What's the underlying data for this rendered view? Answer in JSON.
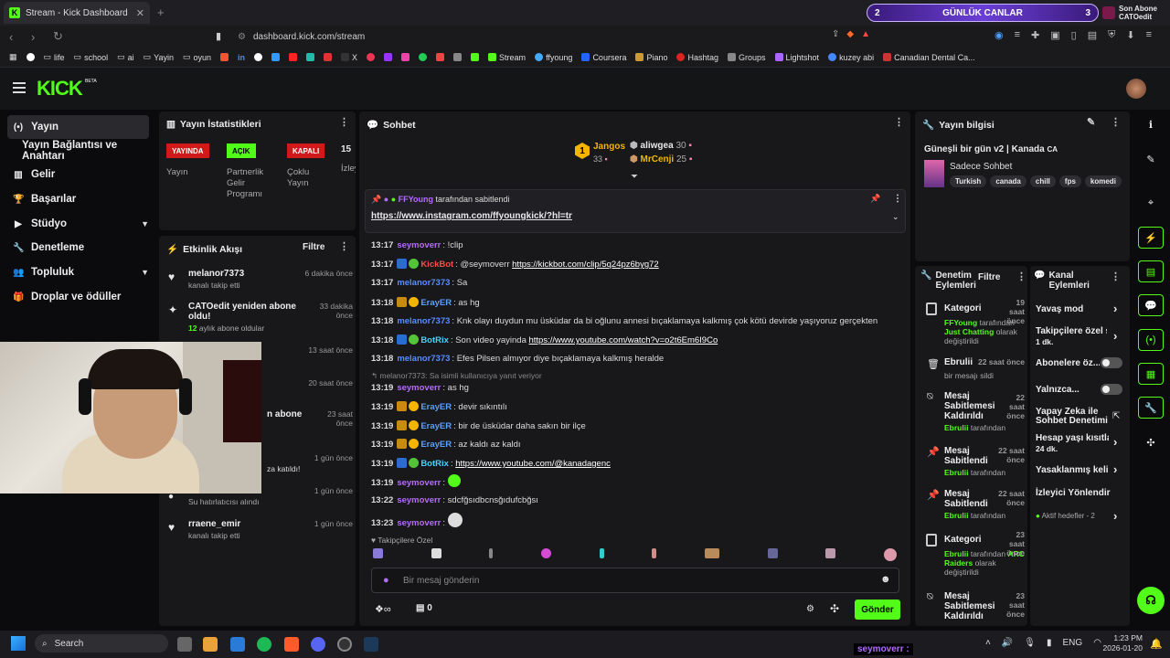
{
  "browser": {
    "tab_title": "Stream - Kick Dashboard",
    "url": "dashboard.kick.com/stream",
    "bookmarks": [
      "life",
      "school",
      "ai",
      "Yayin",
      "oyun",
      "in",
      "X",
      "Stream",
      "ffyoung",
      "Coursera",
      "Piano",
      "Hashtag",
      "Groups",
      "Lightshot",
      "kuzey abi",
      "Canadian Dental Ca..."
    ]
  },
  "banner": {
    "left": "2",
    "label": "GÜNLÜK CANLAR",
    "right": "3"
  },
  "subscriber": {
    "title": "Son Abone",
    "name": "CATOedit"
  },
  "brand": {
    "logo": "KICK",
    "beta": "BETA"
  },
  "sidebar": {
    "items": [
      "Yayın",
      "Yayın Bağlantısı ve Anahtarı",
      "Gelir",
      "Başarılar",
      "Stüdyo",
      "Denetleme",
      "Topluluk",
      "Droplar ve ödüller"
    ]
  },
  "stats": {
    "title": "Yayın İstatistikleri",
    "b1": "YAYINDA",
    "b2": "AÇIK",
    "b3": "KAPALI",
    "b4": "15",
    "l1": "Yayın",
    "l2": "Partnerlik Gelir Programı",
    "l3": "Çoklu Yayın",
    "l4": "İzley"
  },
  "feed": {
    "title": "Etkinlik Akışı",
    "filter": "Filtre",
    "items": [
      {
        "name": "melanor7373",
        "sub": "kanalı takip etti",
        "time": "6 dakika önce"
      },
      {
        "name": "CATOedit yeniden abone oldu!",
        "sub": "aylık abone oldular",
        "sub_count": "12",
        "time": "33 dakika önce"
      },
      {
        "name": "",
        "sub": "",
        "time": "13 saat önce"
      },
      {
        "name": "",
        "sub": "",
        "time": "20 saat önce"
      },
      {
        "name": "n abone",
        "sub": "",
        "time": "23 saat önce"
      },
      {
        "name": "",
        "sub": "za katıldı!",
        "time": "1 gün önce"
      },
      {
        "name": "",
        "sub": "Su hatırlatıcısı alındı",
        "time": "1 gün önce"
      },
      {
        "name": "rraene_emir",
        "sub": "kanalı takip etti",
        "time": "1 gün önce"
      }
    ]
  },
  "chat": {
    "title": "Sohbet",
    "top": [
      {
        "name": "Jangos",
        "count": "33"
      },
      {
        "name": "aliwgea",
        "count": "30"
      },
      {
        "name": "MrCenji",
        "count": "25"
      }
    ],
    "rank": "1",
    "pinned_by": "FFYoung",
    "pinned_suffix": "tarafından sabitlendi",
    "pinned_link": "https://www.instagram.com/ffyoungkick/?hl=tr",
    "messages": [
      {
        "time": "13:17",
        "user": "seymoverr",
        "color": "#b46bff",
        "text": "!clip",
        "link": ""
      },
      {
        "time": "13:17",
        "user": "KickBot",
        "color": "#ff4a4a",
        "text": "@seymoverr",
        "link": "https://kickbot.com/clip/5q24pz6byg72"
      },
      {
        "time": "13:17",
        "user": "melanor7373",
        "color": "#5a8cff",
        "text": "Sa",
        "link": ""
      },
      {
        "time": "13:18",
        "user": "ErayER",
        "color": "#5aa0ff",
        "text": "as hg",
        "link": ""
      },
      {
        "time": "13:18",
        "user": "melanor7373",
        "color": "#5a8cff",
        "text": "Knk olayı duydun mu üsküdar da bi oğlunu annesi bıçaklamaya kalkmış çok kötü devirde yaşıyoruz gerçekten",
        "link": ""
      },
      {
        "time": "13:18",
        "user": "BotRix",
        "color": "#3dd6ff",
        "text": "Son video yayinda",
        "link": "https://www.youtube.com/watch?v=o2t6Em6I9Co"
      },
      {
        "time": "13:18",
        "user": "melanor7373",
        "color": "#5a8cff",
        "text": "Efes Pilsen almıyor diye bıçaklamaya kalkmış heralde",
        "link": ""
      },
      {
        "time": "13:19",
        "user": "seymoverr",
        "color": "#b46bff",
        "text": "as hg",
        "link": ""
      },
      {
        "time": "13:19",
        "user": "ErayER",
        "color": "#5aa0ff",
        "text": "devir sıkıntılı",
        "link": ""
      },
      {
        "time": "13:19",
        "user": "ErayER",
        "color": "#5aa0ff",
        "text": "bir de üsküdar daha sakın bir ilçe",
        "link": ""
      },
      {
        "time": "13:19",
        "user": "ErayER",
        "color": "#5aa0ff",
        "text": "az kaldı az kaldı",
        "link": ""
      },
      {
        "time": "13:19",
        "user": "BotRix",
        "color": "#3dd6ff",
        "text": "",
        "link": "https://www.youtube.com/@kanadagenc"
      },
      {
        "time": "13:19",
        "user": "seymoverr",
        "color": "#b46bff",
        "text": "",
        "link": ""
      },
      {
        "time": "13:22",
        "user": "seymoverr",
        "color": "#b46bff",
        "text": "sdcfğsıdbcnsğıdufcbğsı",
        "link": ""
      },
      {
        "time": "13:23",
        "user": "seymoverr",
        "color": "#b46bff",
        "text": "",
        "link": ""
      }
    ],
    "reply_note": "melanor7373: Sa isimli kullanıcıya yanıt veriyor",
    "follower_only": "Takipçilere Özel",
    "placeholder": "Bir mesaj gönderin",
    "points": "0",
    "send": "Gönder"
  },
  "info": {
    "title": "Yayın bilgisi",
    "stream_title": "Güneşli bir gün v2 | Kanada",
    "flag": "CA",
    "category": "Sadece Sohbet",
    "tags": [
      "Turkish",
      "canada",
      "chill",
      "fps",
      "komedi"
    ]
  },
  "modlog": {
    "title": "Denetim Eylemleri",
    "filter": "Filtre",
    "items": [
      {
        "action": "Kategori",
        "l1": "FFYoung",
        "l1b": "tarafından",
        "l2": "Just Chatting",
        "l2b": "olarak",
        "l3": "değiştirildi",
        "time": "19 saat önce"
      },
      {
        "action": "Ebrulii",
        "l1": "bir mesajı sildi",
        "time": "22 saat önce"
      },
      {
        "action": "Mesaj Sabitlemesi Kaldırıldı",
        "l1": "Ebrulii",
        "l1b": "tarafından",
        "time": "22 saat önce"
      },
      {
        "action": "Mesaj Sabitlendi",
        "l1": "Ebrulii",
        "l1b": "tarafından",
        "time": "22 saat önce"
      },
      {
        "action": "Mesaj Sabitlendi",
        "l1": "Ebrulii",
        "l1b": "tarafından",
        "time": "22 saat önce"
      },
      {
        "action": "Kategori",
        "l1": "Ebrulii",
        "l1b": "tarafından",
        "l2": "ARC Raiders",
        "l2b": "olarak",
        "l3": "değiştirildi",
        "time": "23 saat önce"
      },
      {
        "action": "Mesaj Sabitlemesi Kaldırıldı",
        "l1": "Ebrulii",
        "l1b": "tarafından",
        "time": "23 saat önce"
      }
    ]
  },
  "channel": {
    "title": "Kanal Eylemleri",
    "items": [
      {
        "label": "Yavaş mod",
        "sub": ""
      },
      {
        "label": "Takipçilere özel s",
        "sub": "1 dk."
      },
      {
        "label": "Abonelere öz...",
        "sub": ""
      },
      {
        "label": "Yalnızca...",
        "sub": ""
      },
      {
        "label": "Yapay Zeka ile Sohbet Denetimi",
        "sub": ""
      },
      {
        "label": "Hesap yaşı kısıtla",
        "sub": "24 dk."
      },
      {
        "label": "Yasaklanmış kelin",
        "sub": ""
      },
      {
        "label": "İzleyici Yönlendir",
        "sub": "Aktif hedefler - 2"
      }
    ]
  },
  "taskbar": {
    "search": "Search",
    "lang": "ENG",
    "time": "1:23 PM",
    "date": "2026-01-20",
    "overlay_user": "seymoverr"
  }
}
